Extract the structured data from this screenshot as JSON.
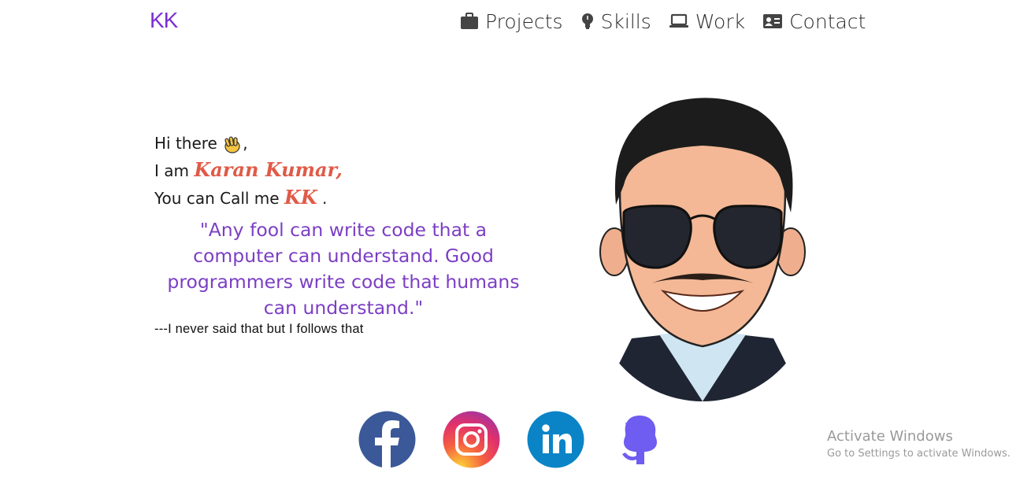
{
  "header": {
    "logo": "KK",
    "nav": [
      {
        "label": "Projects",
        "icon": "briefcase-icon"
      },
      {
        "label": "Skills",
        "icon": "lightbulb-icon"
      },
      {
        "label": "Work",
        "icon": "laptop-icon"
      },
      {
        "label": "Contact",
        "icon": "contact-card-icon"
      }
    ]
  },
  "intro": {
    "greeting": "Hi there",
    "greeting_suffix": ",",
    "iam": "I am",
    "name": "Karan Kumar,",
    "call_me": "You can Call me",
    "nickname": "KK",
    "period": "."
  },
  "quote": {
    "text": "\"Any fool can write code that a computer can understand. Good programmers write code that humans can understand.\"",
    "attribution": "---I never said that but I follows that"
  },
  "social": [
    {
      "name": "facebook-icon",
      "color": "#3b5998"
    },
    {
      "name": "instagram-icon",
      "color": "#e1306c"
    },
    {
      "name": "linkedin-icon",
      "color": "#0a84c6"
    },
    {
      "name": "github-icon",
      "color": "#6f5cf0"
    }
  ],
  "watermark": {
    "title": "Activate Windows",
    "subtitle": "Go to Settings to activate Windows."
  },
  "colors": {
    "accent_purple": "#7b2fd3",
    "quote_purple": "#7b3fc4",
    "name_red": "#e05a47"
  }
}
